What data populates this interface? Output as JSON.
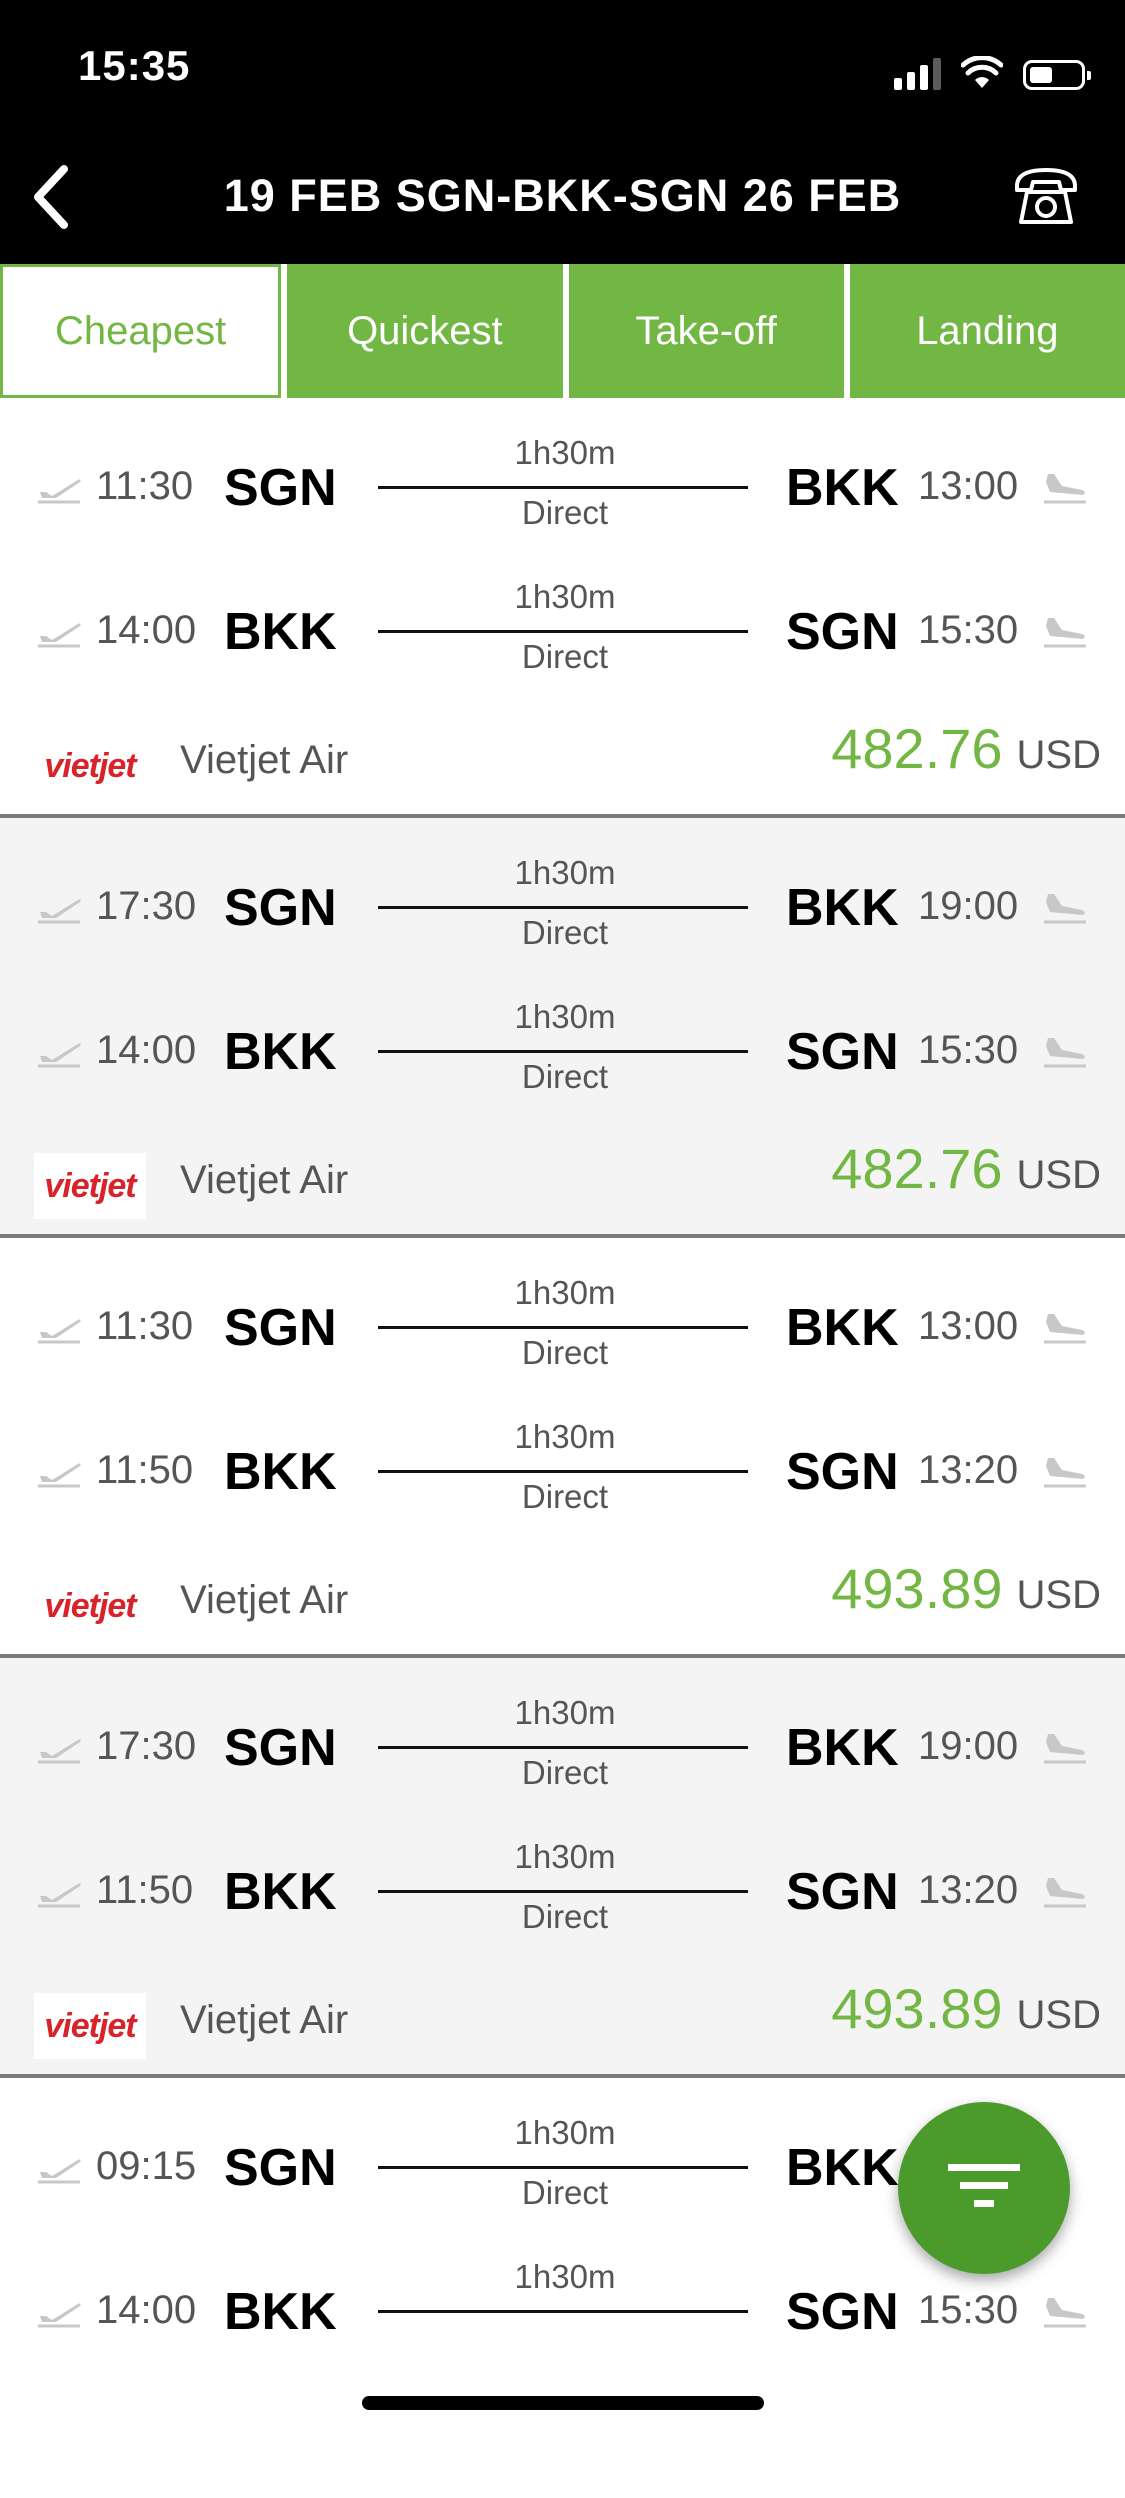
{
  "status": {
    "time": "15:35"
  },
  "nav": {
    "title": "19 FEB SGN-BKK-SGN 26 FEB"
  },
  "tabs": [
    {
      "label": "Cheapest",
      "active": true
    },
    {
      "label": "Quickest",
      "active": false
    },
    {
      "label": "Take-off",
      "active": false
    },
    {
      "label": "Landing",
      "active": false
    }
  ],
  "colors": {
    "accent": "#72b744",
    "fab": "#4b9a2c",
    "airline_red": "#d7232a"
  },
  "icons": {
    "back": "chevron-left-icon",
    "phone": "phone-icon",
    "departure": "takeoff-icon",
    "arrival": "landing-icon",
    "filter": "filter-icon"
  },
  "results": [
    {
      "outbound": {
        "dep_time": "11:30",
        "from": "SGN",
        "duration": "1h30m",
        "stops": "Direct",
        "to": "BKK",
        "arr_time": "13:00"
      },
      "inbound": {
        "dep_time": "14:00",
        "from": "BKK",
        "duration": "1h30m",
        "stops": "Direct",
        "to": "SGN",
        "arr_time": "15:30"
      },
      "airline_logo": "vietjet",
      "airline": "Vietjet Air",
      "price": "482.76",
      "currency": "USD"
    },
    {
      "outbound": {
        "dep_time": "17:30",
        "from": "SGN",
        "duration": "1h30m",
        "stops": "Direct",
        "to": "BKK",
        "arr_time": "19:00"
      },
      "inbound": {
        "dep_time": "14:00",
        "from": "BKK",
        "duration": "1h30m",
        "stops": "Direct",
        "to": "SGN",
        "arr_time": "15:30"
      },
      "airline_logo": "vietjet",
      "airline": "Vietjet Air",
      "price": "482.76",
      "currency": "USD"
    },
    {
      "outbound": {
        "dep_time": "11:30",
        "from": "SGN",
        "duration": "1h30m",
        "stops": "Direct",
        "to": "BKK",
        "arr_time": "13:00"
      },
      "inbound": {
        "dep_time": "11:50",
        "from": "BKK",
        "duration": "1h30m",
        "stops": "Direct",
        "to": "SGN",
        "arr_time": "13:20"
      },
      "airline_logo": "vietjet",
      "airline": "Vietjet Air",
      "price": "493.89",
      "currency": "USD"
    },
    {
      "outbound": {
        "dep_time": "17:30",
        "from": "SGN",
        "duration": "1h30m",
        "stops": "Direct",
        "to": "BKK",
        "arr_time": "19:00"
      },
      "inbound": {
        "dep_time": "11:50",
        "from": "BKK",
        "duration": "1h30m",
        "stops": "Direct",
        "to": "SGN",
        "arr_time": "13:20"
      },
      "airline_logo": "vietjet",
      "airline": "Vietjet Air",
      "price": "493.89",
      "currency": "USD"
    },
    {
      "outbound": {
        "dep_time": "09:15",
        "from": "SGN",
        "duration": "1h30m",
        "stops": "Direct",
        "to": "BKK"
      },
      "inbound": {
        "dep_time": "14:00",
        "from": "BKK",
        "duration": "1h30m",
        "to": "SGN",
        "arr_time": "15:30"
      }
    }
  ]
}
